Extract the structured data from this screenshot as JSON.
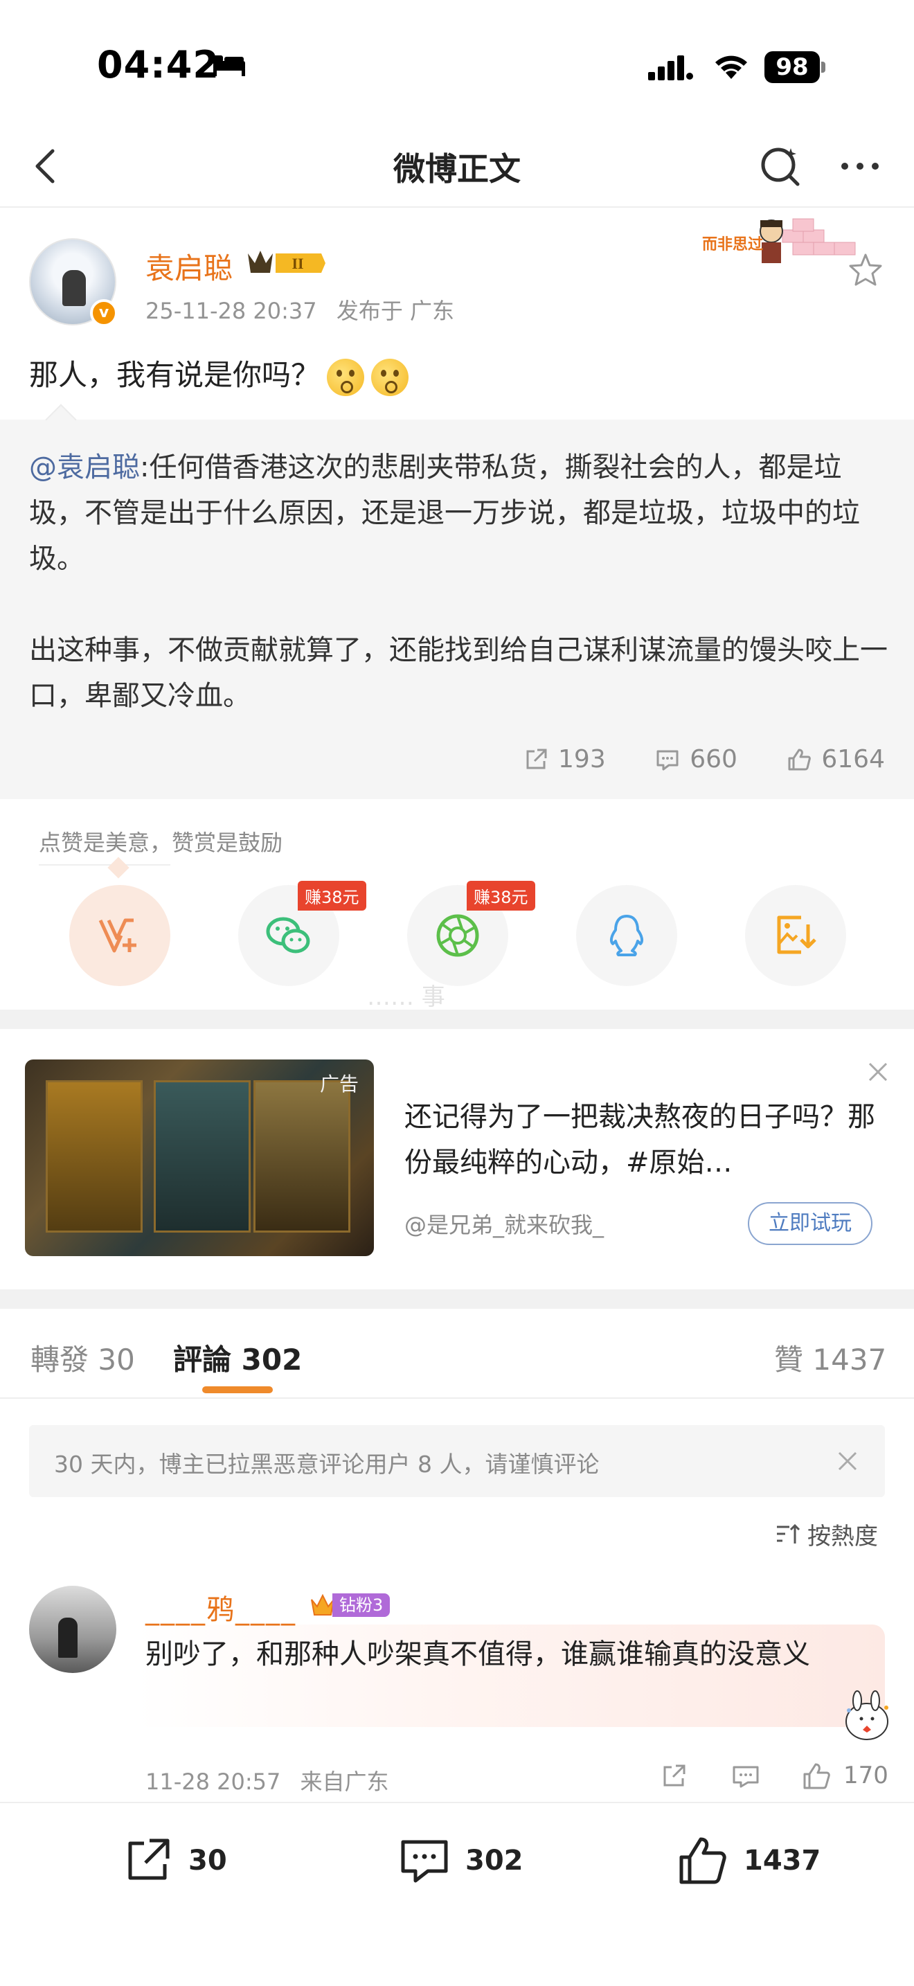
{
  "status": {
    "time": "04:42",
    "battery": "98"
  },
  "nav": {
    "title": "微博正文"
  },
  "post": {
    "author": "袁启聪",
    "vip_level": "II",
    "verified_mark": "v",
    "timestamp": "25-11-28 20:37",
    "location": "发布于 广东",
    "text": "那人，我有说是你吗？",
    "sticker_text": "而非思过"
  },
  "quote": {
    "mention": "@袁启聪",
    "text1": ":任何借香港这次的悲剧夹带私货，撕裂社会的人，都是垃圾，不管是出于什么原因，还是退一万步说，都是垃圾，垃圾中的垃圾。",
    "text2": "出这种事，不做贡献就算了，还能找到给自己谋利谋流量的馒头咬上一口，卑鄙又冷血。",
    "reposts": "193",
    "comments": "660",
    "likes": "6164"
  },
  "reward": {
    "hint": "点赞是美意，赞赏是鼓励",
    "earn_label_1": "赚38元",
    "earn_label_2": "赚38元",
    "faded_text": "…… 事"
  },
  "ad": {
    "tag": "广告",
    "title": "还记得为了一把裁决熬夜的日子吗？那份最纯粹的心动，#原始…",
    "source": "@是兄弟_就来砍我_",
    "cta": "立即试玩"
  },
  "tabs": {
    "repost_label": "轉發",
    "repost_count": "30",
    "comment_label": "評論",
    "comment_count": "302",
    "like_label": "贊",
    "like_count": "1437"
  },
  "notice": {
    "text": "30 天内，博主已拉黑恶意评论用户 8 人，请谨慎评论"
  },
  "sort": {
    "label": "按熱度"
  },
  "comment": {
    "user": "____鸦____",
    "fan_label": "钻粉3",
    "text": "别吵了，和那种人吵架真不值得，谁赢谁输真的没意义",
    "time": "11-28 20:57",
    "location": "来自广东",
    "likes": "170"
  },
  "bottom": {
    "reposts": "30",
    "comments": "302",
    "likes": "1437"
  },
  "colors": {
    "accent": "#e8731a",
    "link": "#4d6aa0",
    "badge": "#e8442d"
  }
}
